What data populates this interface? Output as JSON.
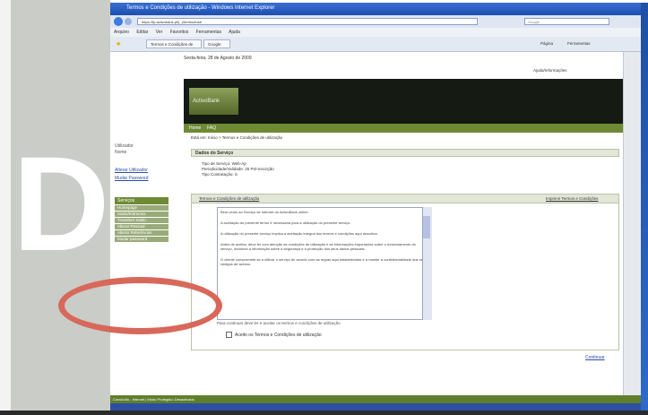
{
  "magazine": {
    "letter": "D"
  },
  "browser": {
    "title": "Termos e Condições de utilização - Windows Internet Explorer",
    "address": "https://fp.activobank.pt/(..)/termsofuse",
    "search_placeholder": "Google",
    "menu": [
      "Arquivo",
      "Editar",
      "Ver",
      "Favoritos",
      "Ferramentas",
      "Ajuda"
    ],
    "tabs": [
      "Termos e Condições de ...",
      "Google"
    ],
    "right_tools": [
      "Página",
      "Ferramentas"
    ]
  },
  "page": {
    "date": "Sexta-feira, 28 de Agosto de 2009",
    "logo": "ActivoBank",
    "help": "Ajuda/Informações",
    "nav": [
      "Home",
      "FAQ"
    ],
    "breadcrumb": "Está em: Início > Termos e Condições de utilização",
    "user": [
      "Utilizador",
      "Nome"
    ],
    "left_links": [
      "Alterar Utilizador",
      "Mudar Password"
    ],
    "services_header": "Serviços",
    "services": [
      "Homepage",
      "Saldo/Extractos",
      "Transferir Saldo",
      "Alterar Pessoal",
      "Alterar Referências",
      "Mudar password"
    ],
    "service_title": "Dados do Serviço",
    "service_info": [
      "Tipo de Serviço: Web-Ap",
      "Periodicidade/Validade: 25 Pré-inscrição",
      "Tipo Contratação: S"
    ],
    "terms_tab": "Termos e Condições de utilização",
    "print_button": "Imprimir Termos e Condições",
    "terms_paragraphs": [
      "Bem-vindo ao Serviço de Internet do ActivoBank online.",
      "A aceitação do presente termo é necessária para a utilização do presente serviço.",
      "A utilização do presente serviço implica a aceitação integral dos termos e condições aqui descritos.",
      "Antes de aceitar, deve ler com atenção as condições de utilização e as informações importantes sobre o funcionamento do serviço, incluindo a informação sobre a segurança e a protecção dos seus dados pessoais.",
      "O cliente compromete-se a utilizar o serviço de acordo com as regras aqui estabelecidas e a manter a confidencialidade dos seus códigos de acesso."
    ],
    "accept_instruction": "Para continuar deve ler e aceitar os termos e condições de utilização",
    "accept_label": "Aceito os Termos e Condições de utilização",
    "continue_link": "Continuar"
  },
  "status": "Concluído - Internet | Modo Protegido: Desactivado"
}
